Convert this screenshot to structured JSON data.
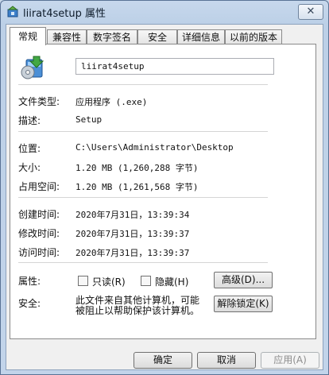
{
  "window": {
    "title": "liirat4setup 属性",
    "close_glyph": "✕"
  },
  "tabs": [
    {
      "label": "常规",
      "active": true
    },
    {
      "label": "兼容性"
    },
    {
      "label": "数字签名"
    },
    {
      "label": "安全"
    },
    {
      "label": "详细信息"
    },
    {
      "label": "以前的版本"
    }
  ],
  "general": {
    "file_name": "liirat4setup",
    "rows": {
      "type_label": "文件类型:",
      "type_value": "应用程序 (.exe)",
      "desc_label": "描述:",
      "desc_value": "Setup",
      "location_label": "位置:",
      "location_value": "C:\\Users\\Administrator\\Desktop",
      "size_label": "大小:",
      "size_value": "1.20 MB (1,260,288 字节)",
      "disk_label": "占用空间:",
      "disk_value": "1.20 MB (1,261,568 字节)",
      "created_label": "创建时间:",
      "created_value": "2020年7月31日，13:39:34",
      "modified_label": "修改时间:",
      "modified_value": "2020年7月31日，13:39:37",
      "accessed_label": "访问时间:",
      "accessed_value": "2020年7月31日，13:39:37"
    },
    "attributes": {
      "label": "属性:",
      "readonly_label": "只读(R)",
      "hidden_label": "隐藏(H)",
      "advanced_button": "高级(D)..."
    },
    "security": {
      "label": "安全:",
      "text_line1": "此文件来自其他计算机，可能",
      "text_line2": "被阻止以帮助保护该计算机。",
      "unblock_button": "解除锁定(K)"
    }
  },
  "footer": {
    "ok": "确定",
    "cancel": "取消",
    "apply": "应用(A)"
  },
  "colors": {
    "title_bg": "#c9d8ea",
    "accent": "#3a8a3a"
  }
}
